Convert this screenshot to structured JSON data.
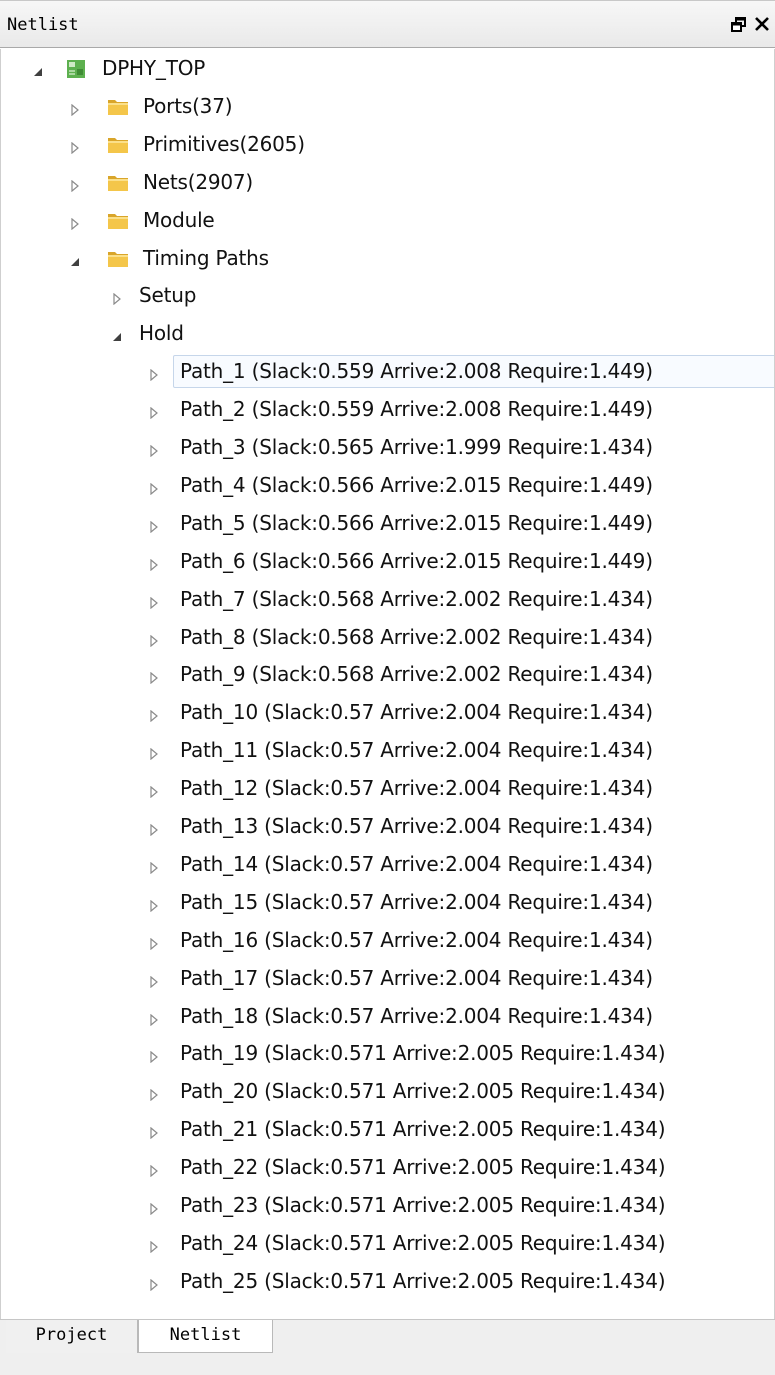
{
  "panel": {
    "title": "Netlist",
    "float_icon": "float-window-icon",
    "close_icon": "close-icon"
  },
  "tree": {
    "root": {
      "label": "DPHY_TOP",
      "icon": "module-chip-icon",
      "expanded": true
    },
    "folders": [
      {
        "label": "Ports(37)",
        "expanded": false
      },
      {
        "label": "Primitives(2605)",
        "expanded": false
      },
      {
        "label": "Nets(2907)",
        "expanded": false
      },
      {
        "label": "Module",
        "expanded": false
      },
      {
        "label": "Timing Paths",
        "expanded": true
      }
    ],
    "timing": [
      {
        "label": "Setup",
        "expanded": false
      },
      {
        "label": "Hold",
        "expanded": true
      }
    ],
    "hold_paths": [
      "Path_1 (Slack:0.559 Arrive:2.008 Require:1.449)",
      "Path_2 (Slack:0.559 Arrive:2.008 Require:1.449)",
      "Path_3 (Slack:0.565 Arrive:1.999 Require:1.434)",
      "Path_4 (Slack:0.566 Arrive:2.015 Require:1.449)",
      "Path_5 (Slack:0.566 Arrive:2.015 Require:1.449)",
      "Path_6 (Slack:0.566 Arrive:2.015 Require:1.449)",
      "Path_7 (Slack:0.568 Arrive:2.002 Require:1.434)",
      "Path_8 (Slack:0.568 Arrive:2.002 Require:1.434)",
      "Path_9 (Slack:0.568 Arrive:2.002 Require:1.434)",
      "Path_10 (Slack:0.57 Arrive:2.004 Require:1.434)",
      "Path_11 (Slack:0.57 Arrive:2.004 Require:1.434)",
      "Path_12 (Slack:0.57 Arrive:2.004 Require:1.434)",
      "Path_13 (Slack:0.57 Arrive:2.004 Require:1.434)",
      "Path_14 (Slack:0.57 Arrive:2.004 Require:1.434)",
      "Path_15 (Slack:0.57 Arrive:2.004 Require:1.434)",
      "Path_16 (Slack:0.57 Arrive:2.004 Require:1.434)",
      "Path_17 (Slack:0.57 Arrive:2.004 Require:1.434)",
      "Path_18 (Slack:0.57 Arrive:2.004 Require:1.434)",
      "Path_19 (Slack:0.571 Arrive:2.005 Require:1.434)",
      "Path_20 (Slack:0.571 Arrive:2.005 Require:1.434)",
      "Path_21 (Slack:0.571 Arrive:2.005 Require:1.434)",
      "Path_22 (Slack:0.571 Arrive:2.005 Require:1.434)",
      "Path_23 (Slack:0.571 Arrive:2.005 Require:1.434)",
      "Path_24 (Slack:0.571 Arrive:2.005 Require:1.434)",
      "Path_25 (Slack:0.571 Arrive:2.005 Require:1.434)"
    ],
    "selected_path_index": 0
  },
  "tabs": [
    {
      "label": "Project",
      "active": false
    },
    {
      "label": "Netlist",
      "active": true
    }
  ],
  "colors": {
    "folder": "#f4c64a",
    "folder_dark": "#d9a52a",
    "chip": "#5db04f",
    "selection_border": "#c6d6ea"
  }
}
